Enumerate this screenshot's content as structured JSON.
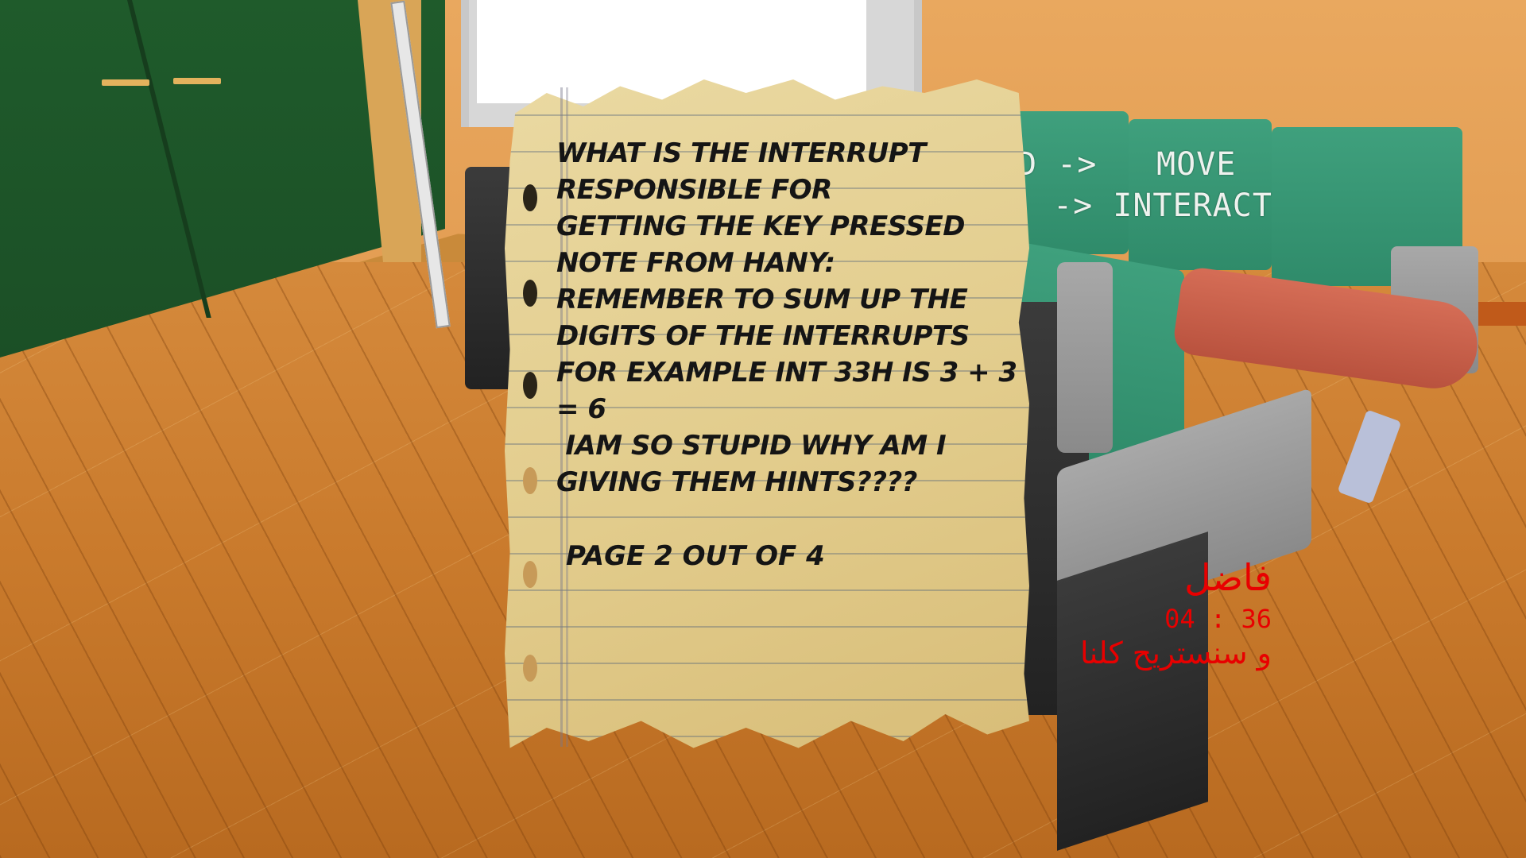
{
  "note": {
    "lines": [
      "What is the interrupt",
      "responsible for",
      "getting the key pressed",
      "Note from Hany:",
      "remember to sum up the",
      "digits of the interrupts",
      "for example int 33h is 3 + 3",
      "= 6",
      " iam so stupid why am i",
      "giving them hints????"
    ],
    "page_indicator": "Page 2 out of 4"
  },
  "hud_controls": {
    "move_key": "D ->",
    "move_label": "MOVE",
    "interact_label": "-> INTERACT"
  },
  "hud_status": {
    "player_name": "فاضل",
    "timer": "04 : 36",
    "message": "و سنستريح كلنا"
  },
  "colors": {
    "hud_red": "#e80000",
    "paper": "#e2cc8c",
    "floor": "#c97a2c",
    "green_board": "#1f5b2b",
    "chair_green": "#3fa07d"
  }
}
